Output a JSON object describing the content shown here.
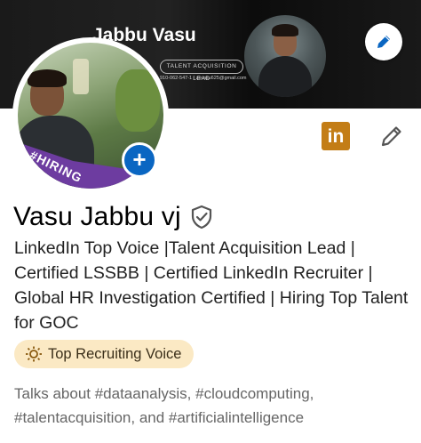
{
  "banner": {
    "title": "Jabbu Vasu",
    "role": "TALENT ACQUISITION LEAD",
    "contact": "910-062-547-1 | zsvasu625@gmail.com"
  },
  "profile": {
    "hiring_frame": "#HIRING",
    "name": "Vasu Jabbu vj",
    "headline": "LinkedIn Top Voice |Talent Acquisition Lead | Certified LSSBB | Certified LinkedIn Recruiter | Global HR Investigation Certified | Hiring Top Talent for GOC",
    "badge_label": "Top Recruiting Voice",
    "talks_about": "Talks about #dataanalysis, #cloudcomputing, #talentacquisition, and #artificialintelligence"
  },
  "icons": {
    "edit_banner": "pencil-icon",
    "add_photo": "plus-icon",
    "linkedin": "in",
    "edit_profile": "pencil-icon",
    "verified": "shield-check-icon",
    "voice": "sun-icon"
  },
  "colors": {
    "accent_blue": "#0a66c2",
    "hiring_purple": "#6d3ca0",
    "badge_bg": "#fbe9c4",
    "linkedin_badge": "#c37d16"
  }
}
